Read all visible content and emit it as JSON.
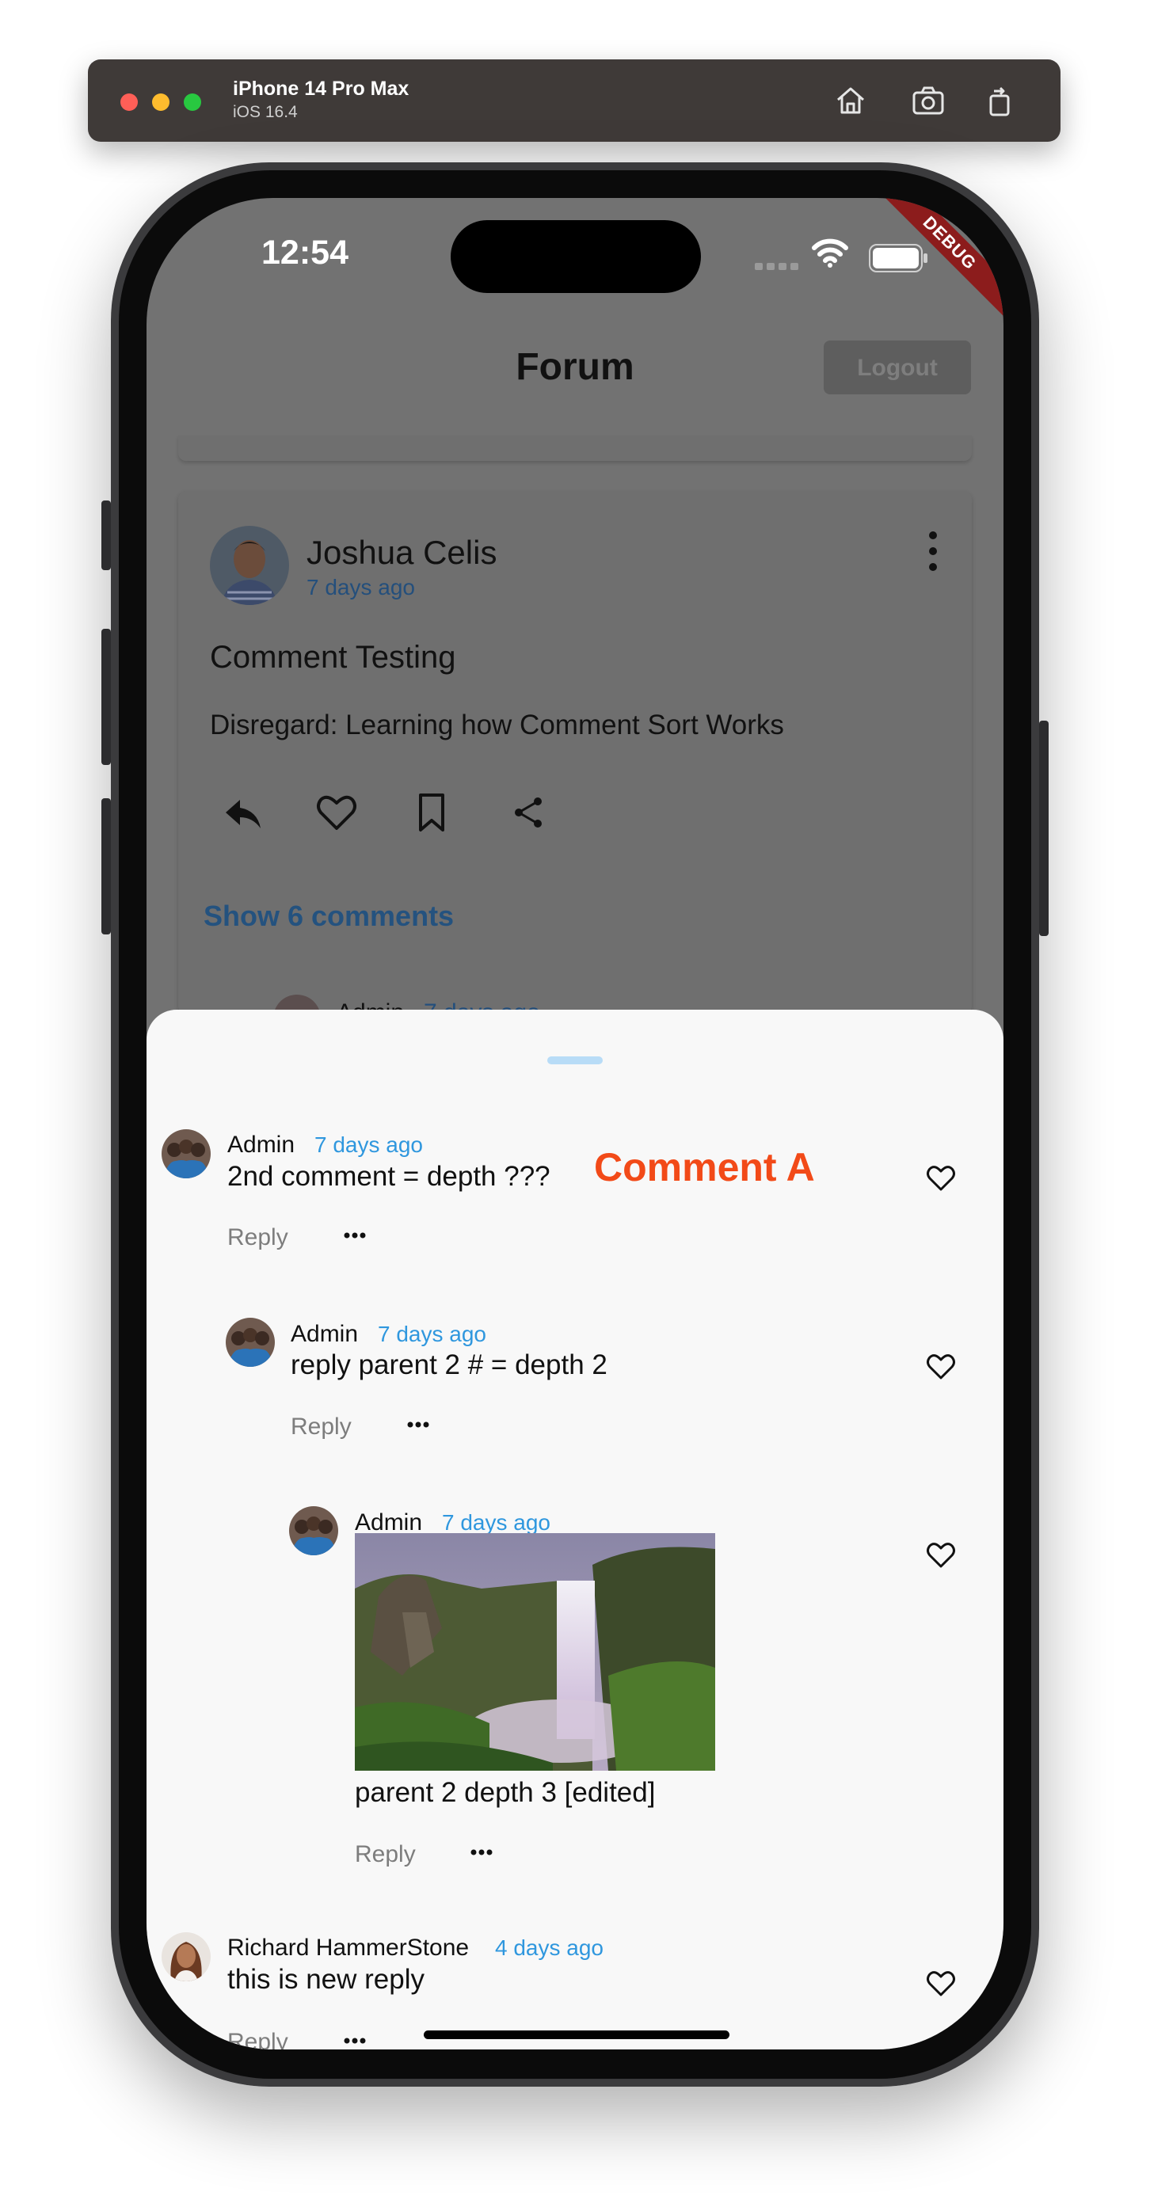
{
  "simulator": {
    "device_name": "iPhone 14 Pro Max",
    "os_version": "iOS 16.4",
    "toolbar_icons": [
      "home-icon",
      "screenshot-icon",
      "rotate-icon"
    ]
  },
  "status_bar": {
    "time": "12:54",
    "debug_banner": "DEBUG"
  },
  "app_bar": {
    "title": "Forum",
    "logout_label": "Logout"
  },
  "post": {
    "author": "Joshua Celis",
    "time": "7 days ago",
    "title": "Comment Testing",
    "body": "Disregard: Learning how Comment Sort Works",
    "actions": [
      "reply-icon",
      "heart-icon",
      "bookmark-icon",
      "share-icon"
    ],
    "show_comments_label": "Show 6 comments",
    "peek_author": "Admin",
    "peek_time": "7 days ago"
  },
  "sheet": {
    "annotation": "Comment A",
    "comments": [
      {
        "author": "Admin",
        "time": "7 days ago",
        "text": "2nd comment = depth ???",
        "reply_label": "Reply"
      },
      {
        "author": "Admin",
        "time": "7 days ago",
        "text": "reply parent 2 # = depth 2",
        "reply_label": "Reply"
      },
      {
        "author": "Admin",
        "time": "7 days ago",
        "text": "parent 2 depth 3 [edited]",
        "reply_label": "Reply",
        "image": "waterfall-photo"
      },
      {
        "author": "Richard HammerStone",
        "time": "4 days ago",
        "text": "this is new reply",
        "reply_label": "Reply"
      }
    ]
  },
  "colors": {
    "link_blue": "#2f97de",
    "annotation_red": "#f24a18",
    "sheet_bg": "#f8f8f8",
    "scrim": "#727272"
  }
}
